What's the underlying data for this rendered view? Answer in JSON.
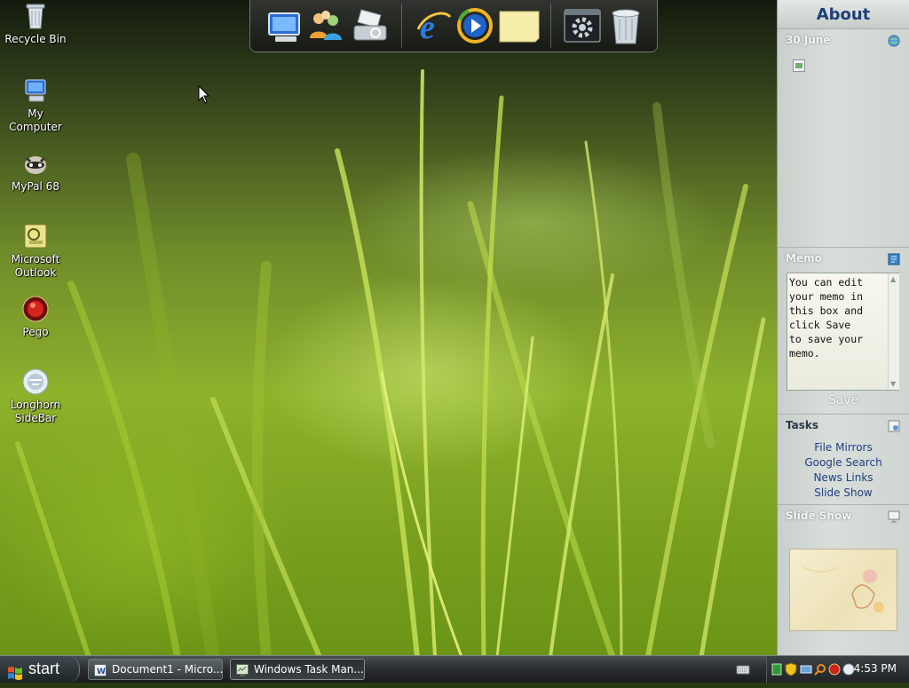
{
  "desktop": {
    "icons": [
      {
        "label": "Recycle Bin",
        "icon": "recycle-bin-icon"
      },
      {
        "label": "My Computer",
        "icon": "computer-icon"
      },
      {
        "label": "MyPal 68",
        "icon": "mypal-icon"
      },
      {
        "label": "Microsoft Outlook",
        "icon": "outlook-icon"
      },
      {
        "label": "Pego",
        "icon": "pego-icon"
      },
      {
        "label": "Longhorn SideBar",
        "icon": "sidebar-app-icon"
      }
    ]
  },
  "dock": {
    "items": [
      {
        "icon": "computer-icon"
      },
      {
        "icon": "users-icon"
      },
      {
        "icon": "printer-icon"
      },
      {
        "icon": "internet-explorer-icon"
      },
      {
        "icon": "media-player-icon"
      },
      {
        "icon": "sticky-note-icon"
      },
      {
        "icon": "control-panel-icon"
      },
      {
        "icon": "trash-icon"
      }
    ]
  },
  "sidebar": {
    "header": "About",
    "calendar": {
      "title": "30 June"
    },
    "memo": {
      "title": "Memo",
      "text": "You can edit\nyour memo in\nthis box and\nclick Save\nto save your\nmemo.",
      "save_label": "Save"
    },
    "tasks": {
      "title": "Tasks",
      "links": [
        "File Mirrors",
        "Google Search",
        "News Links",
        "Slide Show"
      ]
    },
    "slideshow": {
      "title": "Slide Show"
    }
  },
  "taskbar": {
    "start_label": "start",
    "windows": [
      {
        "label": "Document1 - Micro...",
        "icon": "word-icon"
      },
      {
        "label": "Windows Task Man...",
        "icon": "task-manager-icon"
      }
    ],
    "clock": "4:53 PM"
  },
  "colors": {
    "sidebar_link": "#1f3f7f",
    "sidebar_header": "#1c3f7a",
    "taskbar": "#2b2f31"
  }
}
